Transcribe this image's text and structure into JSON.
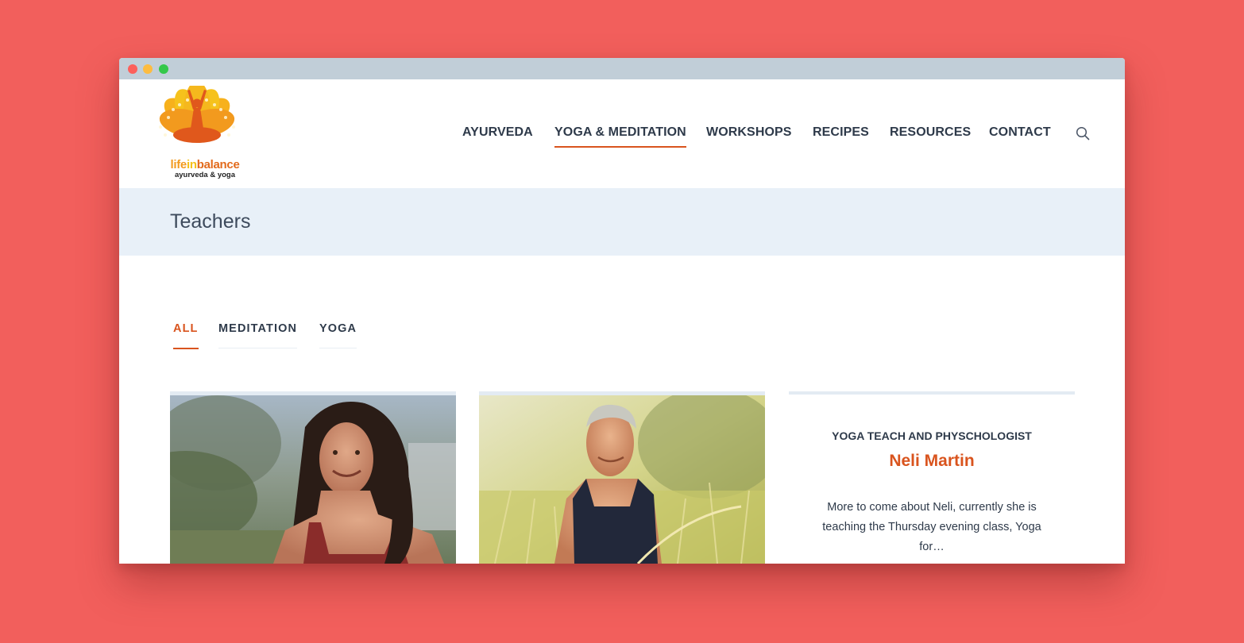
{
  "logo": {
    "name_part1": "life",
    "name_part2": "in",
    "name_part3": "balance",
    "subtitle": "ayurveda & yoga"
  },
  "nav": {
    "items": [
      {
        "label": "AYURVEDA"
      },
      {
        "label": "YOGA & MEDITATION",
        "active": true
      },
      {
        "label": "WORKSHOPS"
      },
      {
        "label": "RECIPES"
      },
      {
        "label": "RESOURCES"
      },
      {
        "label": "CONTACT"
      }
    ],
    "search_icon": "search-icon"
  },
  "page": {
    "title": "Teachers"
  },
  "filters": [
    {
      "label": "ALL",
      "active": true
    },
    {
      "label": "MEDITATION"
    },
    {
      "label": "YOGA"
    }
  ],
  "teacher": {
    "role": "YOGA TEACH AND PHYSCHOLOGIST",
    "name": "Neli Martin",
    "excerpt": "More to come about Neli, currently she is teaching the Thursday evening class, Yoga for…"
  },
  "colors": {
    "accent": "#d9541e",
    "background": "#f25f5c",
    "banner": "#e8f0f8",
    "text": "#2e3a4a"
  }
}
